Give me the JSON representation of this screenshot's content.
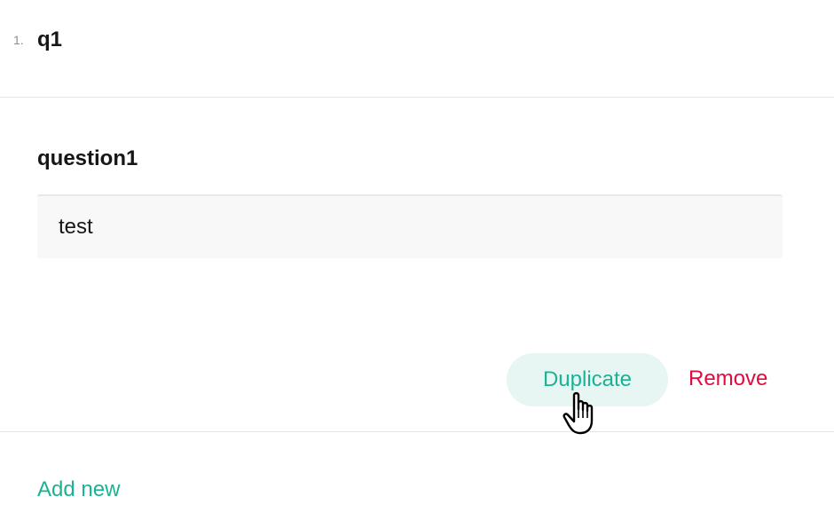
{
  "question": {
    "number": "1.",
    "title": "q1"
  },
  "panel": {
    "field_label": "question1",
    "input_value": "test"
  },
  "actions": {
    "duplicate_label": "Duplicate",
    "remove_label": "Remove"
  },
  "footer": {
    "add_new_label": "Add new"
  },
  "colors": {
    "accent": "#19b394",
    "accent_light": "#e8f6f3",
    "danger": "#e50a3e",
    "input_bg": "#f8f8f8"
  },
  "cursor": {
    "icon": "hand-pointer-icon"
  }
}
